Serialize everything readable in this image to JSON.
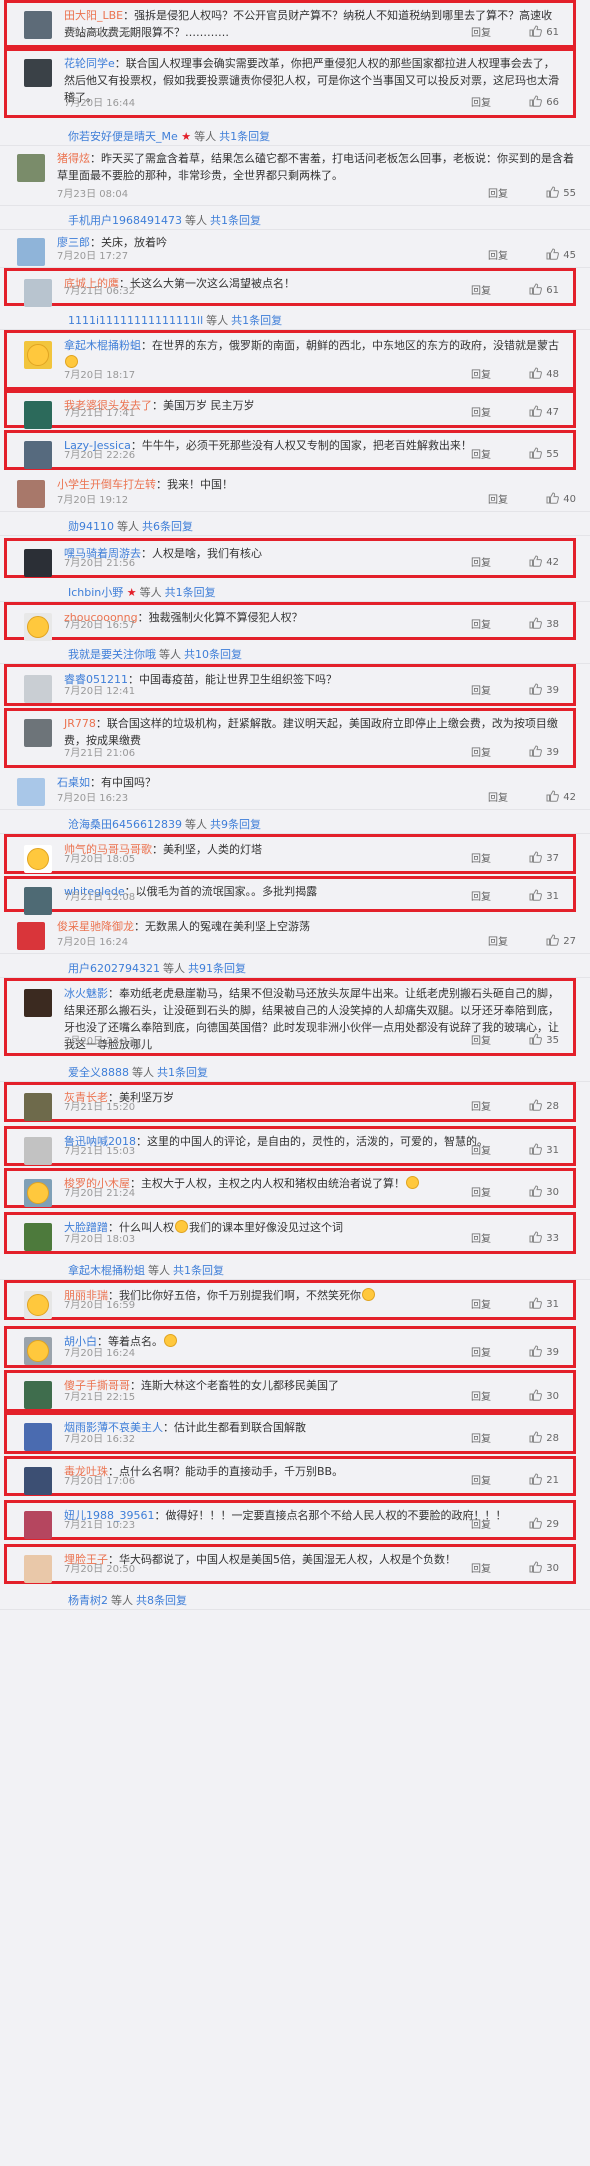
{
  "comments": [
    {
      "name": "田大阳_LBE",
      "text": "：强拆是侵犯人权吗？不公开官员财产算不？纳税人不知道税纳到哪里去了算不？高速收费站高收费无期限算不？…………",
      "time": "7月20日 22:59",
      "reply": "回复",
      "likes": "61",
      "highlight": true,
      "avatar": "#5d6b78"
    },
    {
      "name": "花轮同学e",
      "text": "：联合国人权理事会确实需要改革，你把严重侵犯人权的那些国家都拉进人权理事会去了，然后他又有投票权，假如我要投票谴责你侵犯人权，可是你这个当事国又可以投反对票，这尼玛也太滑稽了。",
      "time": "7月20日 16:44",
      "reply": "回复",
      "likes": "66",
      "highlight": true,
      "avatar": "#3a4147"
    },
    {
      "name": "猪得炫",
      "text": "：昨天买了需盒含着草，结果怎么磕它都不害羞，打电话问老板怎么回事，老板说：你买到的是含着草里面最不要脸的那种，非常珍贵，全世界都只剩两株了。",
      "time": "7月23日 08:04",
      "reply": "回复",
      "likes": "55",
      "highlight": false,
      "avatar": "#7a8c6a"
    },
    {
      "name": "廖三郎",
      "text": "：关床，放着吟",
      "time": "7月20日 17:27",
      "reply": "回复",
      "likes": "45",
      "highlight": false,
      "avatar": "#8fb4d9"
    },
    {
      "name": "底城上的鹰",
      "text": "：长这么大第一次这么渴望被点名！",
      "time": "7月21日 06:32",
      "reply": "回复",
      "likes": "61",
      "highlight": true,
      "avatar": "#b8c4cf"
    },
    {
      "name": "拿起木棍捅粉蛆",
      "text": "：在世界的东方，俄罗斯的南面，朝鲜的西北，中东地区的东方的政府，没错就是蒙古",
      "time": "7月20日 18:17",
      "reply": "回复",
      "likes": "48",
      "highlight": true,
      "avatar": "#f2c53d",
      "emoji": true
    },
    {
      "name": "我老婆很头发去了",
      "text": "：美国万岁 民主万岁",
      "time": "7月21日 17:41",
      "reply": "回复",
      "likes": "47",
      "highlight": true,
      "avatar": "#2c6a5b"
    },
    {
      "name": "Lazy-Jessica",
      "text": "：牛牛牛，必须干死那些没有人权又专制的国家，把老百姓解救出来！",
      "time": "7月20日 22:26",
      "reply": "回复",
      "likes": "55",
      "highlight": true,
      "avatar": "#566a7e"
    },
    {
      "name": "小学生开倒车打左转",
      "text": "：我来！中国！",
      "time": "7月20日 19:12",
      "reply": "回复",
      "likes": "40",
      "highlight": false,
      "avatar": "#a8786a"
    },
    {
      "name": "嘿马骑着周游去",
      "text": "：人权是啥，我们有核心",
      "time": "7月20日 21:56",
      "reply": "回复",
      "likes": "42",
      "highlight": true,
      "avatar": "#2b2f36"
    },
    {
      "name": "zhoucooonng",
      "text": "：独裁强制火化算不算侵犯人权？",
      "time": "7月20日 16:57",
      "reply": "回复",
      "likes": "38",
      "highlight": true,
      "avatar": "#e8e8e8"
    },
    {
      "name": "睿睿051211",
      "text": "：中国毒疫苗，能让世界卫生组织签下吗？",
      "time": "7月20日 12:41",
      "reply": "回复",
      "likes": "39",
      "highlight": true,
      "avatar": "#c9ced3"
    },
    {
      "name": "JR778",
      "text": "：联合国这样的垃圾机构，赶紧解散。建议明天起，美国政府立即停止上缴会费，改为按项目缴费，按成果缴费",
      "time": "7月21日 21:06",
      "reply": "回复",
      "likes": "39",
      "highlight": true,
      "avatar": "#6d7479"
    },
    {
      "name": "石桌如",
      "text": "：有中国吗？",
      "time": "7月20日 16:23",
      "reply": "回复",
      "likes": "42",
      "highlight": false,
      "avatar": "#a9c7e8"
    },
    {
      "name": "帅气的马哥马哥歌",
      "text": "：美利坚，人类的灯塔",
      "time": "7月20日 18:05",
      "reply": "回复",
      "likes": "37",
      "highlight": true,
      "avatar": "#ffffff"
    },
    {
      "name": "whiteglede",
      "text": "：以俄毛为首的流氓国家。。多批判揭露",
      "time": "7月21日 12:08",
      "reply": "回复",
      "likes": "31",
      "highlight": true,
      "avatar": "#4e6a74"
    },
    {
      "name": "俊采星驰降御龙",
      "text": "：无数黑人的冤魂在美利坚上空游荡",
      "time": "7月20日 16:24",
      "reply": "回复",
      "likes": "27",
      "highlight": false,
      "avatar": "#d9353a"
    },
    {
      "name": "冰火魅影",
      "text": "：奉劝纸老虎悬崖勒马，结果不但没勒马还放头灰犀牛出来。让纸老虎别搬石头砸自己的脚，结果还那么搬石头，让没砸到石头的脚，结果被自己的人没笑掉的人却痛失双腿。以牙还牙奉陪到底，牙也没了还嘴么奉陪到底，向德国英国借？此时发现非洲小伙伴一点用处都没有说辞了我的玻璃心，让我这一尊脸放哪儿",
      "time": "7月20日 23:13",
      "reply": "回复",
      "likes": "35",
      "highlight": true,
      "avatar": "#3b2a20"
    },
    {
      "name": "灰青长老",
      "text": "：美利坚万岁",
      "time": "7月21日 15:20",
      "reply": "回复",
      "likes": "28",
      "highlight": true,
      "avatar": "#6e6a4b"
    },
    {
      "name": "鲁迅呐喊2018",
      "text": "：这里的中国人的评论，是自由的，灵性的，活泼的，可爱的，智慧的。",
      "time": "7月21日 15:03",
      "reply": "回复",
      "likes": "31",
      "highlight": true,
      "avatar": "#c2c2c2"
    },
    {
      "name": "梭罗的小木屋",
      "text": "：主权大于人权，主权之内人权和猪权由统治者说了算！",
      "time": "7月20日 21:24",
      "reply": "回复",
      "likes": "30",
      "highlight": true,
      "avatar": "#7fa0b7",
      "emoji": true
    },
    {
      "name": "大脸蹭蹭",
      "text": "：什么叫人权",
      "time": "7月20日 18:03",
      "reply": "回复",
      "likes": "33",
      "highlight": true,
      "avatar": "#4d7a3c",
      "midtext": "我们的课本里好像没见过这个词"
    },
    {
      "name": "朋丽非瑞",
      "text": "：我们比你好五倍，你千万别提我们啊，不然笑死你",
      "time": "7月20日 16:59",
      "reply": "回复",
      "likes": "31",
      "highlight": true,
      "avatar": "#e6e6e6",
      "emoji": true
    },
    {
      "name": "胡小白",
      "text": "：等着点名。",
      "time": "7月20日 16:24",
      "reply": "回复",
      "likes": "39",
      "highlight": true,
      "avatar": "#9aa3ac",
      "emoji": true
    },
    {
      "name": "傻子手撕哥哥",
      "text": "：连斯大林这个老畜牲的女儿都移民美国了",
      "time": "7月21日 22:15",
      "reply": "回复",
      "likes": "30",
      "highlight": true,
      "avatar": "#3f6d4d"
    },
    {
      "name": "烟雨影薄不哀美主人",
      "text": "：估计此生都看到联合国解散",
      "time": "7月20日 16:32",
      "reply": "回复",
      "likes": "28",
      "highlight": true,
      "avatar": "#4a6bb0"
    },
    {
      "name": "毒龙吐珠",
      "text": "：点什么名啊？能动手的直接动手，千万别BB。",
      "time": "7月20日 17:06",
      "reply": "回复",
      "likes": "21",
      "highlight": true,
      "avatar": "#3c4f73"
    },
    {
      "name": "妞儿1988_39561",
      "text": "：做得好！！！一定要直接点名那个不给人民人权的不要脸的政府！！！",
      "time": "7月21日 10:23",
      "reply": "回复",
      "likes": "29",
      "highlight": true,
      "avatar": "#b5465f"
    },
    {
      "name": "埋脸王子",
      "text": "：华大码都说了，中国人权是美国5倍，美国湿无人权，人权是个负数！",
      "time": "7月20日 20:50",
      "reply": "回复",
      "likes": "30",
      "highlight": true,
      "avatar": "#e9c8a9"
    }
  ],
  "subrows": [
    {
      "link": "你若安好便是晴天_Me",
      "star": true,
      "rest": "等人",
      "count": "共1条回复"
    },
    {
      "link": "手机用户1968491473",
      "star": false,
      "rest": "等人",
      "count": "共1条回复"
    },
    {
      "link": "1111i11111111111111ll",
      "star": false,
      "rest": "等人",
      "count": "共1条回复"
    },
    {
      "link": "勋94110",
      "star": false,
      "rest": "等人",
      "count": "共6条回复"
    },
    {
      "link": "Ichbin小野",
      "star": true,
      "rest": "等人",
      "count": "共1条回复"
    },
    {
      "link": "我就是要关注你哦",
      "star": false,
      "rest": "等人",
      "count": "共10条回复"
    },
    {
      "link": "沧海桑田6456612839",
      "star": false,
      "rest": "等人",
      "count": "共9条回复"
    },
    {
      "link": "用户6202794321",
      "star": false,
      "rest": "等人",
      "count": "共91条回复"
    },
    {
      "link": "爱全义8888",
      "star": false,
      "rest": "等人",
      "count": "共1条回复"
    },
    {
      "link": "拿起木棍捅粉蛆",
      "star": false,
      "rest": "等人",
      "count": "共1条回复"
    },
    {
      "link": "杨青树2",
      "star": false,
      "rest": "等人",
      "count": "共8条回复"
    }
  ],
  "colors": {
    "highlight": "#e3202a",
    "link": "#3e7ed8",
    "username": "#eb7350"
  }
}
